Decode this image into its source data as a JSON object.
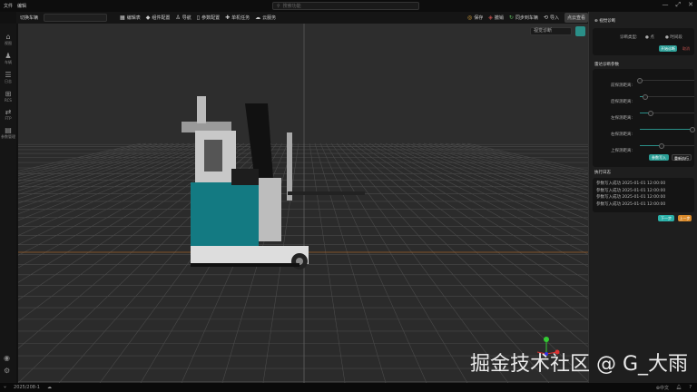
{
  "menu": [
    "文件",
    "编辑"
  ],
  "search": {
    "placeholder": "搜索功能"
  },
  "window_controls": [
    "—",
    "⤢",
    "✕"
  ],
  "toolbar": {
    "vehicle_label": "切换车辆",
    "left": [
      {
        "icon": "table-icon",
        "label": "编辑表"
      },
      {
        "icon": "component-icon",
        "label": "组件配置"
      },
      {
        "icon": "navigation-icon",
        "label": "导航"
      },
      {
        "icon": "param-icon",
        "label": "参数配置"
      },
      {
        "icon": "task-icon",
        "label": "单机任务"
      },
      {
        "icon": "cloud-icon",
        "label": "云服务"
      }
    ],
    "right": [
      {
        "icon": "save-icon",
        "label": "保存",
        "color": "#d9a43a"
      },
      {
        "icon": "undo-icon",
        "label": "撤销",
        "color": "#c0504d"
      },
      {
        "icon": "sync-icon",
        "label": "同步到车辆",
        "color": "#5cb85c"
      },
      {
        "icon": "import-icon",
        "label": "导入",
        "color": "#ccc"
      },
      {
        "icon": "",
        "label": "点云查看",
        "color": "#ccc"
      }
    ]
  },
  "sidebar": [
    {
      "icon": "view-icon",
      "label": "视图"
    },
    {
      "icon": "vehicle-icon",
      "label": "车辆"
    },
    {
      "icon": "log-icon",
      "label": "日志"
    },
    {
      "icon": "rcs-icon",
      "label": "RCS"
    },
    {
      "icon": "ftp-icon",
      "label": "FTP"
    },
    {
      "icon": "params-icon",
      "label": "参数管理"
    }
  ],
  "viewport": {
    "dropdown": "视觉诊断"
  },
  "panel": {
    "title": "视觉诊断",
    "diag_type_label": "诊断类型:",
    "options": [
      "点",
      "时间段"
    ],
    "start_button": "开始诊断",
    "cancel_button": "取消",
    "radar_title": "雷达诊断参数",
    "sliders": [
      {
        "label": "前探测距离:",
        "value": 0.0
      },
      {
        "label": "后探测距离:",
        "value": 0.1
      },
      {
        "label": "左探测距离:",
        "value": 0.2
      },
      {
        "label": "右探测距离:",
        "value": 0.97
      },
      {
        "label": "上探测距离:",
        "value": 0.4
      }
    ],
    "write_button": "参数写入",
    "rerun_button": "重新执行",
    "log_title": "执行日志",
    "logs": [
      "参数写入成功 2025-01-01 12:00:00",
      "参数写入成功 2025-01-01 12:00:00",
      "参数写入成功 2025-01-01 12:00:00",
      "参数写入成功 2025-01-01 12:00:00"
    ],
    "next_button": "下一步",
    "prev_button": "上一步"
  },
  "status": {
    "version": "2025/208-1",
    "language": "中文"
  },
  "watermark": "掘金技术社区 @ G_大雨",
  "colors": {
    "accent": "#2a8f88",
    "orange": "#d9892a"
  }
}
